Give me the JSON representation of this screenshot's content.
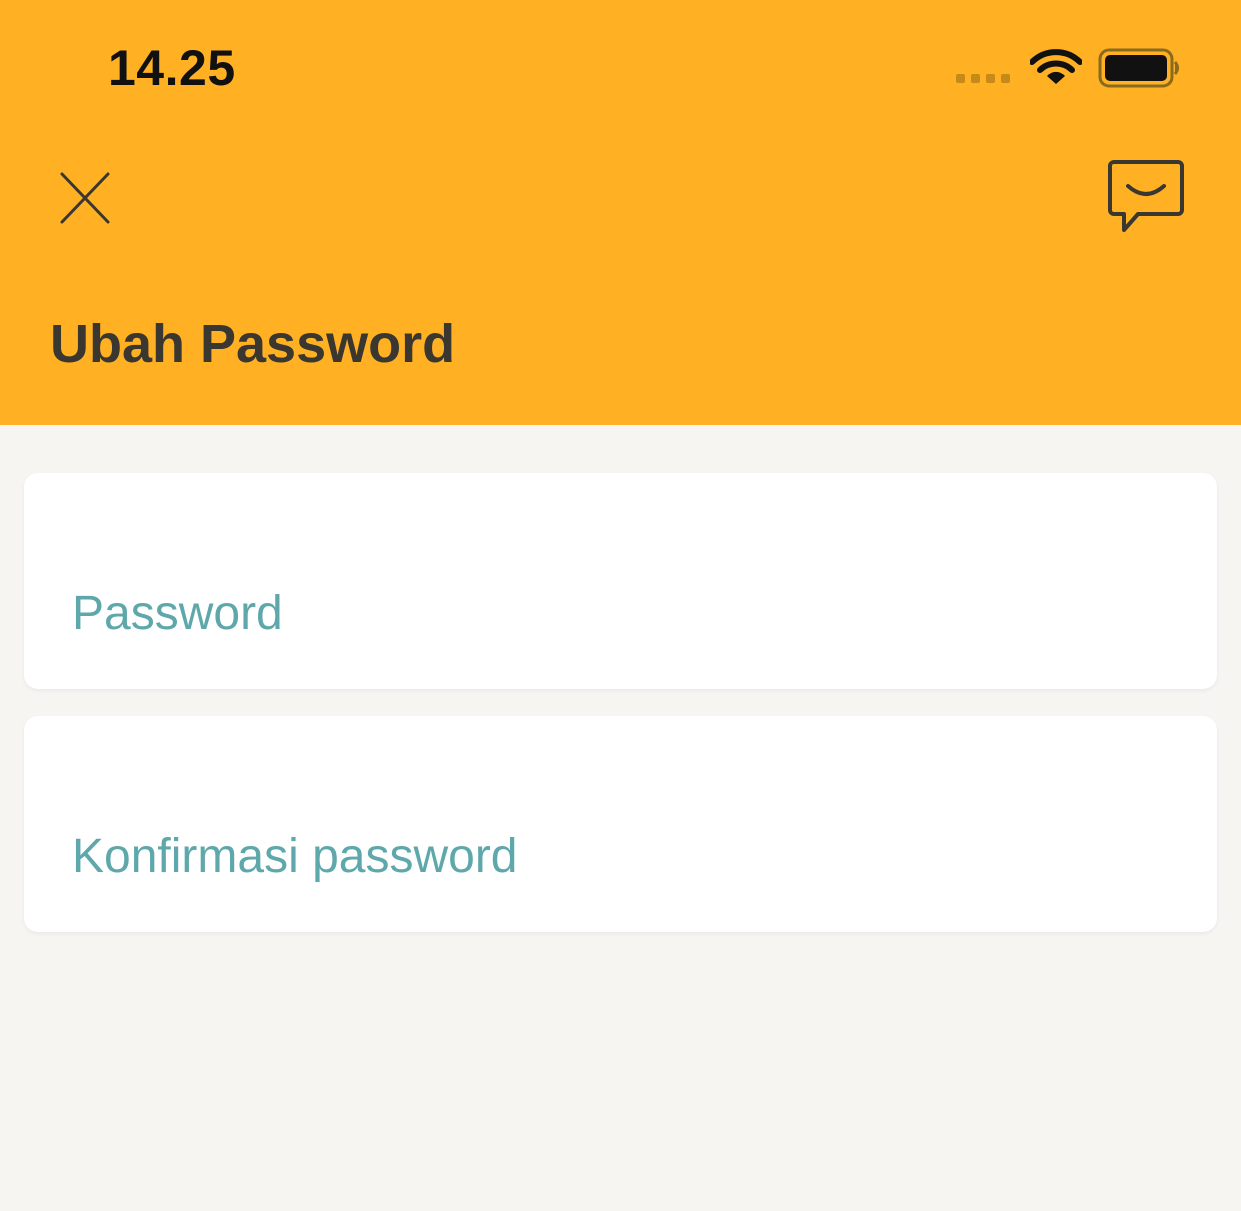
{
  "status_bar": {
    "time": "14.25"
  },
  "header": {
    "title": "Ubah Password",
    "close_icon": "close-icon",
    "chat_icon": "chat-bubble-smile-icon"
  },
  "form": {
    "password": {
      "value": "",
      "placeholder": "Password"
    },
    "confirm_password": {
      "value": "",
      "placeholder": "Konfirmasi password"
    }
  },
  "colors": {
    "header_background": "#ffb123",
    "page_background": "#f6f5f2",
    "placeholder": "#5ea8ab",
    "title": "#3a3630"
  }
}
